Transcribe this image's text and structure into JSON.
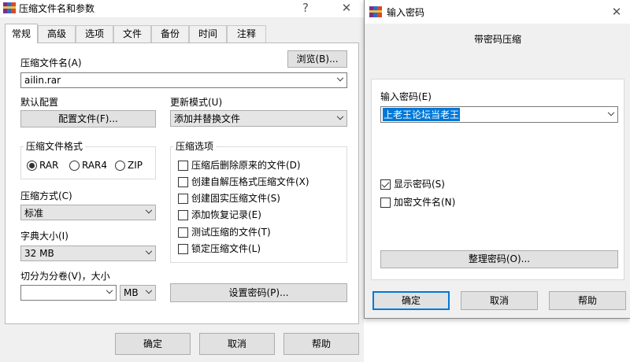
{
  "colors": {
    "accent": "#0078d7",
    "dialog_bg": "#f0f0f0",
    "panel_bg": "#ffffff"
  },
  "main": {
    "title": "压缩文件名和参数",
    "help_glyph": "?",
    "close_glyph": "✕",
    "tabs": [
      {
        "label": "常规",
        "active": true
      },
      {
        "label": "高级"
      },
      {
        "label": "选项"
      },
      {
        "label": "文件"
      },
      {
        "label": "备份"
      },
      {
        "label": "时间"
      },
      {
        "label": "注释"
      }
    ],
    "archive_name_label": "压缩文件名(A)",
    "browse_button": "浏览(B)...",
    "archive_name_value": "ailin.rar",
    "default_profile_label": "默认配置",
    "profiles_button": "配置文件(F)...",
    "update_mode_label": "更新模式(U)",
    "update_mode_value": "添加并替换文件",
    "format_group_title": "压缩文件格式",
    "formats": [
      {
        "label": "RAR",
        "selected": true
      },
      {
        "label": "RAR4",
        "selected": false
      },
      {
        "label": "ZIP",
        "selected": false
      }
    ],
    "options_group_title": "压缩选项",
    "options": [
      {
        "label": "压缩后删除原来的文件(D)",
        "checked": false
      },
      {
        "label": "创建自解压格式压缩文件(X)",
        "checked": false
      },
      {
        "label": "创建固实压缩文件(S)",
        "checked": false
      },
      {
        "label": "添加恢复记录(E)",
        "checked": false
      },
      {
        "label": "测试压缩的文件(T)",
        "checked": false
      },
      {
        "label": "锁定压缩文件(L)",
        "checked": false
      }
    ],
    "method_label": "压缩方式(C)",
    "method_value": "标准",
    "dict_label": "字典大小(I)",
    "dict_value": "32 MB",
    "split_label": "切分为分卷(V)，大小",
    "split_value": "",
    "split_unit": "MB",
    "set_password_button": "设置密码(P)...",
    "ok_button": "确定",
    "cancel_button": "取消",
    "help_button": "帮助"
  },
  "password": {
    "title": "输入密码",
    "close_glyph": "✕",
    "heading": "带密码压缩",
    "input_label": "输入密码(E)",
    "input_value": "上老王论坛当老王",
    "show_password_label": "显示密码(S)",
    "show_password_checked": true,
    "encrypt_names_label": "加密文件名(N)",
    "encrypt_names_checked": false,
    "organize_button": "整理密码(O)...",
    "ok_button": "确定",
    "cancel_button": "取消",
    "help_button": "帮助"
  }
}
